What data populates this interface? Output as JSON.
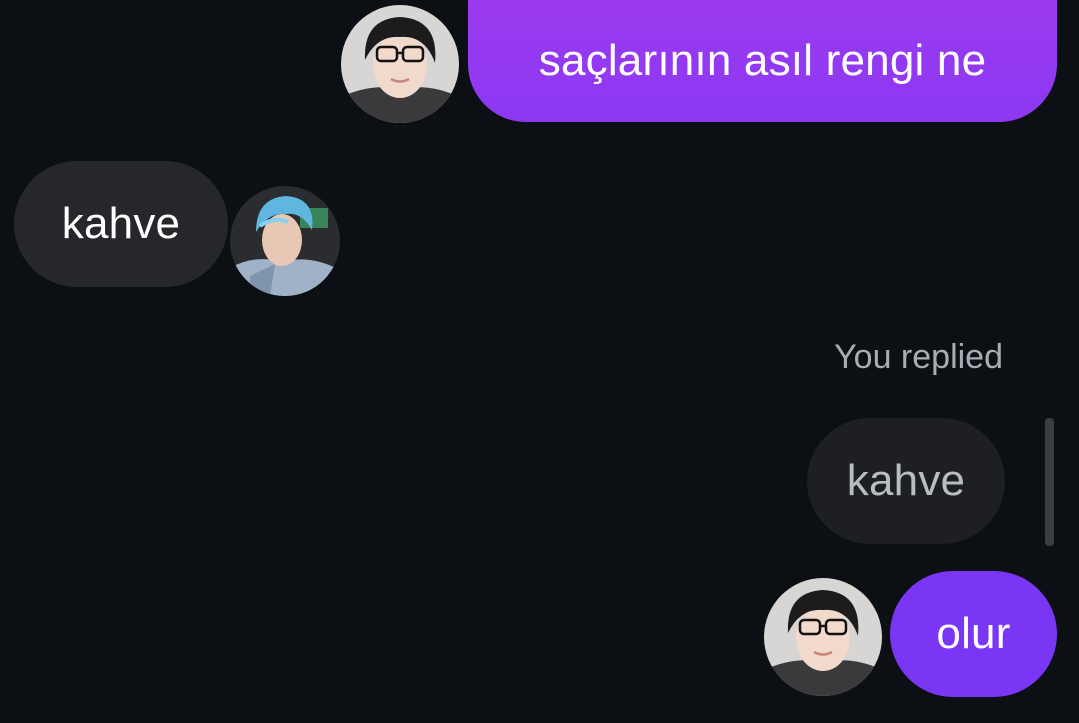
{
  "theme": {
    "background": "#0c0f13",
    "sent_gradient_top": "#9b3af0",
    "sent_gradient_bottom": "#7a36f5",
    "received_bubble": "#25272b",
    "quoted_bubble": "#1d1f22"
  },
  "messages": [
    {
      "direction": "sent",
      "text": "saçlarının asıl rengi ne",
      "avatar": "profile-photo-dark-hair-glasses"
    },
    {
      "direction": "received",
      "text": "kahve",
      "avatar": "profile-photo-blue-hair"
    },
    {
      "direction": "sent",
      "reply_label": "You replied",
      "quoted_text": "kahve",
      "text": "olur",
      "avatar": "profile-photo-dark-hair-glasses"
    }
  ]
}
